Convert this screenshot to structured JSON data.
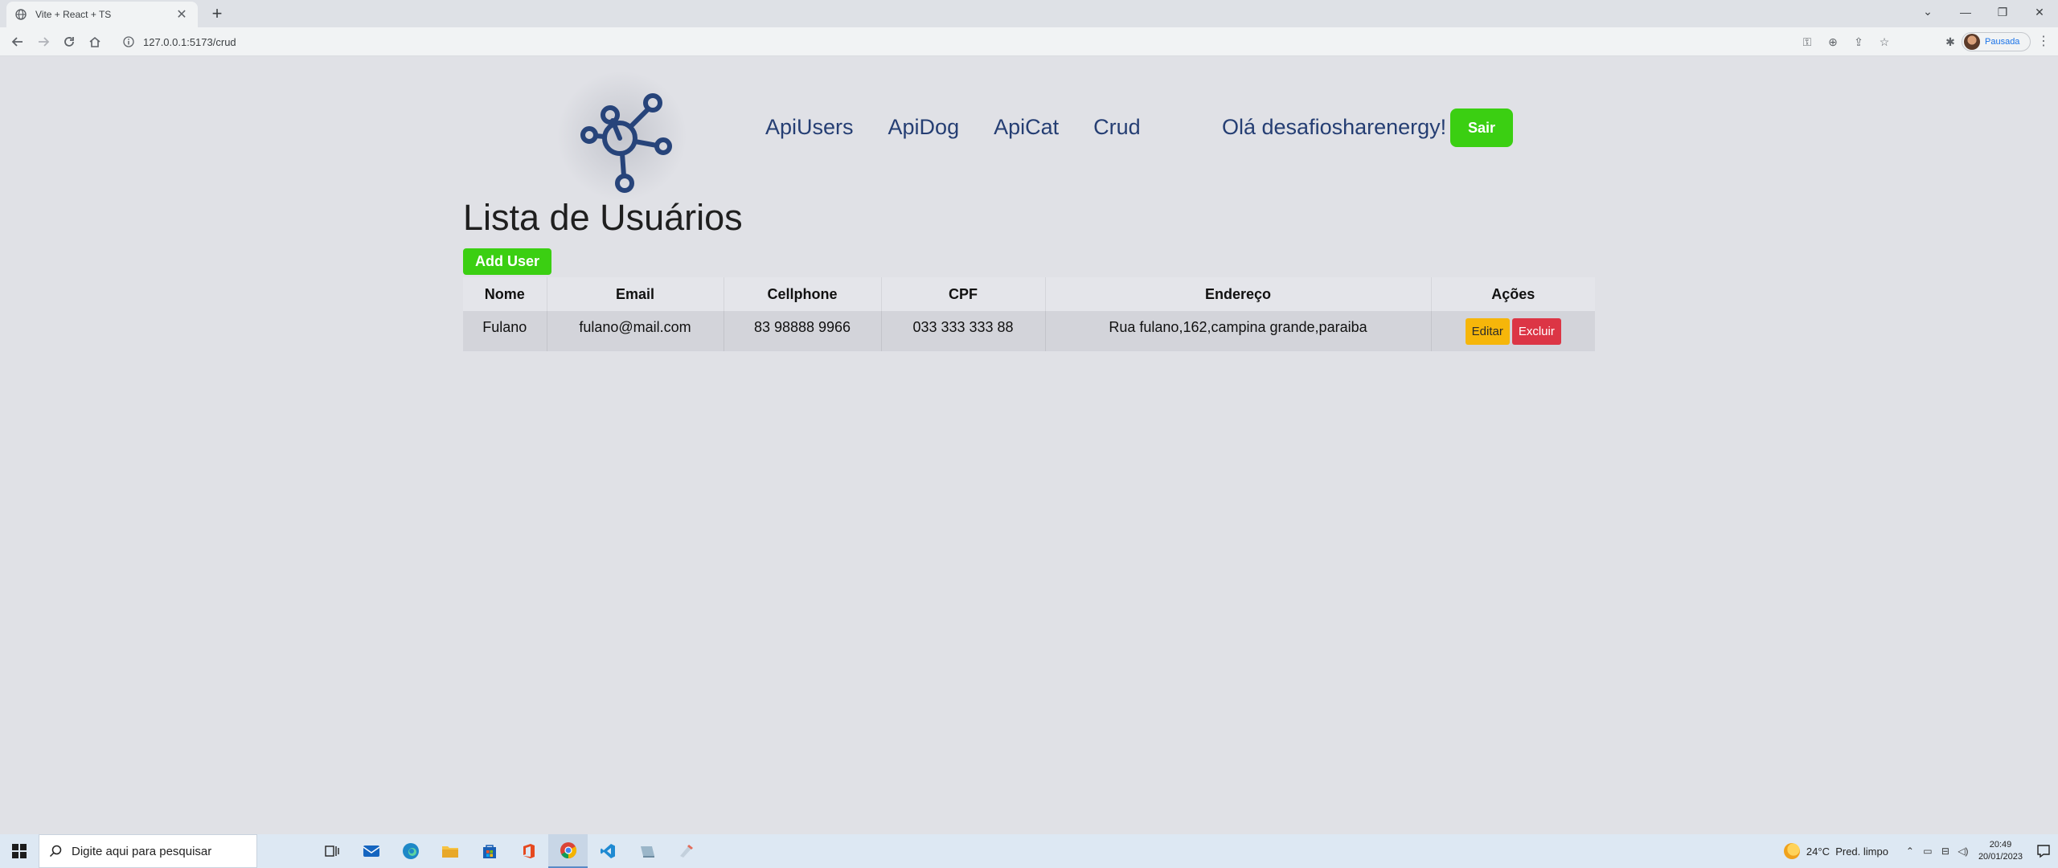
{
  "browser": {
    "tab_title": "Vite + React + TS",
    "tab_close": "✕",
    "new_tab": "+",
    "url": "127.0.0.1:5173/crud",
    "profile_label": "Pausada"
  },
  "header": {
    "nav": [
      "ApiUsers",
      "ApiDog",
      "ApiCat",
      "Crud"
    ],
    "greeting": "Olá desafiosharenergy!",
    "logout_label": "Sair"
  },
  "main": {
    "title": "Lista de Usuários",
    "add_button": "Add User",
    "table": {
      "columns": [
        "Nome",
        "Email",
        "Cellphone",
        "CPF",
        "Endereço",
        "Ações"
      ],
      "rows": [
        {
          "nome": "Fulano",
          "email": "fulano@mail.com",
          "cellphone": "83 98888 9966",
          "cpf": "033 333 333 88",
          "endereco": "Rua fulano,162,campina grande,paraiba",
          "edit_label": "Editar",
          "delete_label": "Excluir"
        }
      ]
    }
  },
  "taskbar": {
    "search_placeholder": "Digite aqui para pesquisar",
    "weather_temp": "24°C",
    "weather_desc": "Pred. limpo",
    "time": "20:49",
    "date": "20/01/2023"
  },
  "colors": {
    "accent_green": "#3bcf12",
    "nav_blue": "#253e73",
    "edit_yellow": "#f6b60a",
    "delete_red": "#dc3545"
  }
}
